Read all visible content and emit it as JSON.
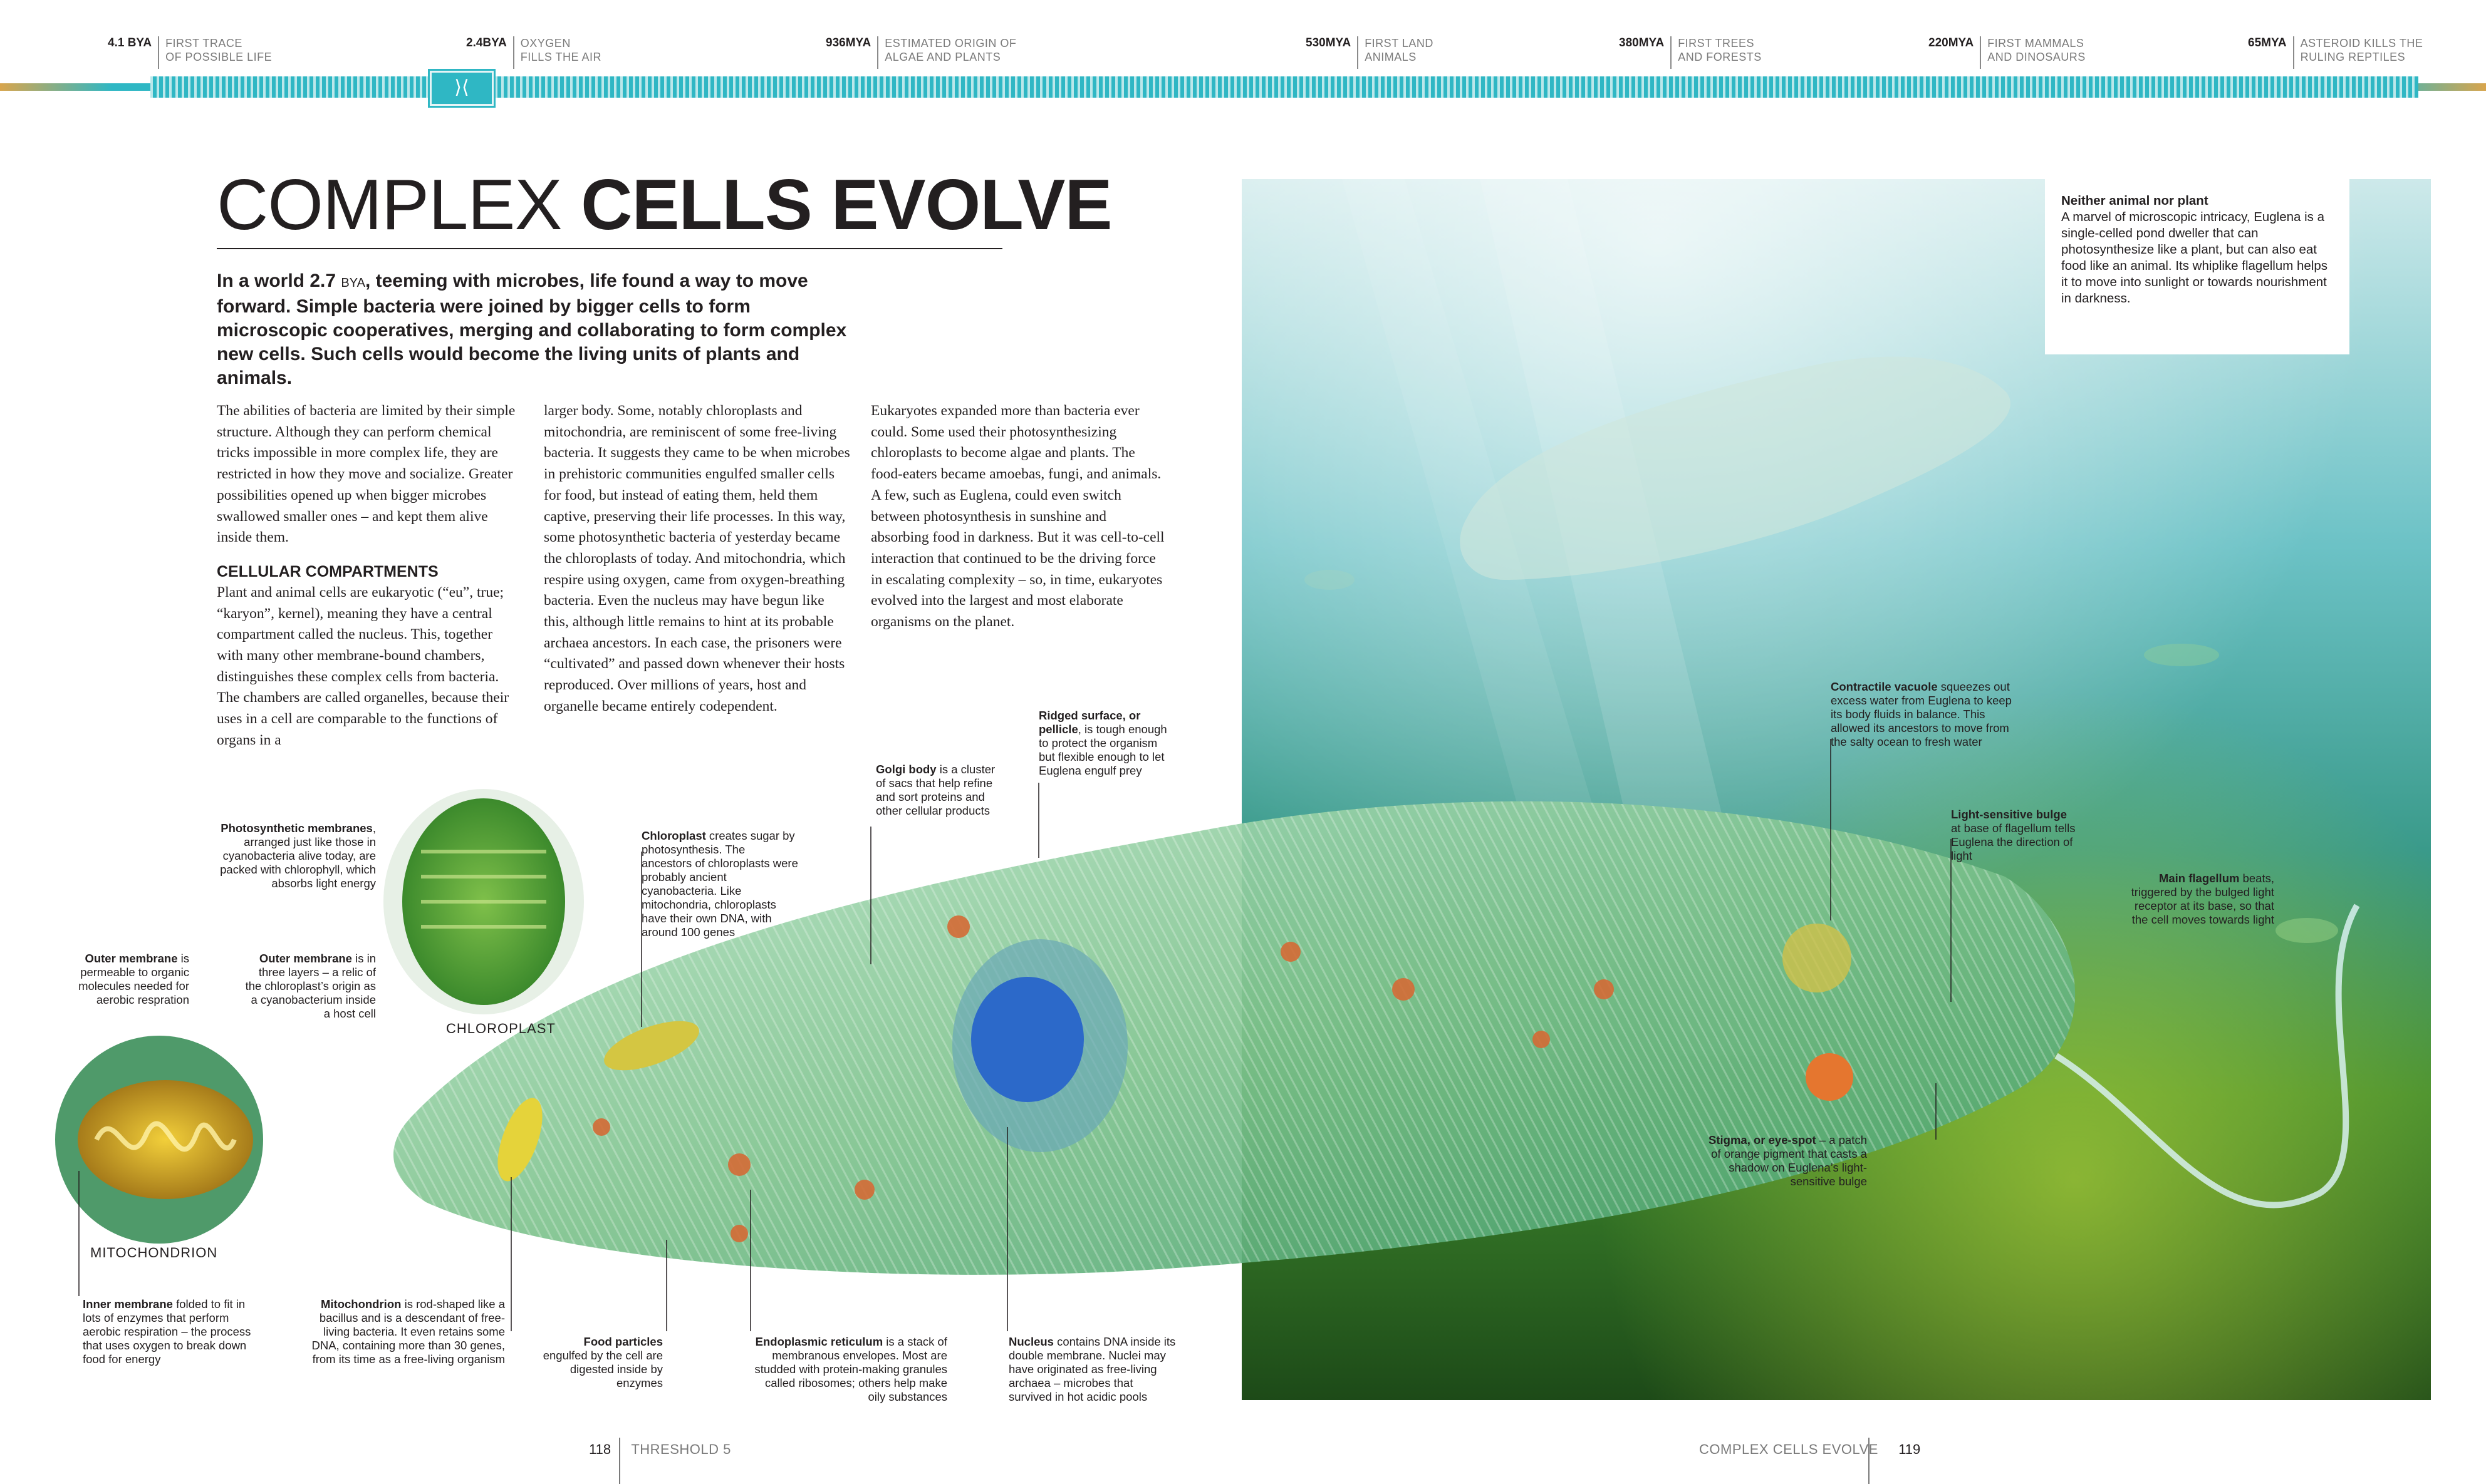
{
  "timeline": [
    {
      "date": "4.1 BYA",
      "desc_lines": [
        "First trace",
        "of possible life"
      ]
    },
    {
      "date": "2.4BYA",
      "desc_lines": [
        "Oxygen",
        "fills the air"
      ]
    },
    {
      "date": "936MYA",
      "desc_lines": [
        "Estimated origin of",
        "algae and plants"
      ]
    },
    {
      "date": "530MYA",
      "desc_lines": [
        "First land",
        "animals"
      ]
    },
    {
      "date": "380MYA",
      "desc_lines": [
        "First trees",
        "and forests"
      ]
    },
    {
      "date": "220MYA",
      "desc_lines": [
        "First mammals",
        "and dinosaurs"
      ]
    },
    {
      "date": "65MYA",
      "desc_lines": [
        "Asteroid kills the",
        "ruling reptiles"
      ]
    }
  ],
  "timeline_marker_glyph": "⟩⟨",
  "colors": {
    "timeline_teal": "#2fb7c4",
    "timeline_gold": "#d8a54d",
    "water_top": "#bfe3e6",
    "water_bottom": "#1d5a22"
  },
  "title": {
    "light": "COMPLEX ",
    "bold": "CELLS EVOLVE"
  },
  "intro": {
    "part1": "In a world 2.7 ",
    "unit": "BYA",
    "part2": ", teeming with microbes, life found a way to move forward. Simple bacteria were joined by bigger cells to form microscopic cooperatives, merging and collaborating to form complex new cells. Such cells would become the living units of plants and animals."
  },
  "body": {
    "p1": "The abilities of bacteria are limited by their simple structure. Although they can perform chemical tricks impossible in more complex life, they are restricted in how they move and socialize. Greater possibilities opened up when bigger microbes swallowed smaller ones – and kept them alive inside them.",
    "subhead": "Cellular compartments",
    "p2": "Plant and animal cells are eukaryotic (“eu”, true; “karyon”, kernel), meaning they have a central compartment called the nucleus. This, together with many other membrane-bound chambers, distinguishes these complex cells from bacteria. The chambers are called organelles, because their uses in a cell are comparable to the functions of organs in a",
    "p3": "larger body. Some, notably chloroplasts and mitochondria, are reminiscent of some free-living bacteria. It suggests they came to be when microbes in prehistoric communities engulfed smaller cells for food, but instead of eating them, held them captive, preserving their life processes. In this way, some photosynthetic bacteria of yesterday became the chloroplasts of today. And mitochondria, which respire using oxygen, came from oxygen-breathing bacteria. Even the nucleus may have begun like this, although little remains to hint at its probable archaea ancestors. In each case, the prisoners were “cultivated” and passed down whenever their hosts reproduced. Over millions of years, host and organelle became entirely codependent.",
    "p4": "Eukaryotes expanded more than bacteria ever could. Some used their photosynthesizing chloroplasts to become algae and plants. The food-eaters became amoebas, fungi, and animals. A few, such as Euglena, could even switch between photosynthesis in sunshine and absorbing food in darkness. But it was cell-to-cell interaction that continued to be the driving force in escalating complexity – so, in time, eukaryotes evolved into the largest and most elaborate organisms on the planet."
  },
  "infobox": {
    "heading": "Neither animal nor plant",
    "text": "A marvel of microscopic intricacy, Euglena is a single-celled pond dweller that can photosynthesize like a plant, but can also eat food like an animal. Its whiplike flagellum helps it to move into sunlight or towards nourishment in darkness."
  },
  "labels": {
    "chloroplast": "CHLOROPLAST",
    "mitochondrion": "MITOCHONDRION"
  },
  "callouts": {
    "photo_membranes": {
      "term": "Photosynthetic membranes",
      "text": ", arranged just like those in cyanobacteria alive today, are packed with chlorophyll, which absorbs light energy"
    },
    "outer_membrane_chloro": {
      "term": "Outer membrane",
      "text": " is in three layers – a relic of the chloroplast’s origin as a cyanobacterium inside a host cell"
    },
    "outer_membrane_mito": {
      "term": "Outer membrane",
      "text": " is permeable to organic molecules needed for aerobic respration"
    },
    "chloroplast": {
      "term": "Chloroplast",
      "text": " creates sugar by photosynthesis. The ancestors of chloroplasts were probably ancient cyanobacteria. Like mitochondria, chloroplasts have their own DNA, with around 100 genes"
    },
    "golgi": {
      "term": "Golgi body",
      "text": " is a cluster of sacs that help refine and sort proteins and other cellular products"
    },
    "pellicle": {
      "term": "Ridged surface, or pellicle",
      "text": ", is tough enough to protect the organism but flexible enough to let Euglena engulf prey"
    },
    "contractile": {
      "term": "Contractile vacuole",
      "text": " squeezes out excess water from Euglena to keep its body fluids in balance. This allowed its ancestors to move from the salty ocean to fresh water"
    },
    "light_bulge": {
      "term": "Light-sensitive bulge",
      "text": " at base of flagellum tells Euglena the direction of light"
    },
    "main_flagellum": {
      "term": "Main flagellum",
      "text": " beats, triggered by the bulged light receptor at its base, so that the cell moves towards light"
    },
    "stigma": {
      "term": "Stigma, or eye-spot",
      "text": " – a patch of orange pigment that casts a shadow on Euglena’s light-sensitive bulge"
    },
    "inner_membrane": {
      "term": "Inner membrane",
      "text": " folded to fit in lots of enzymes that perform aerobic respiration – the process that uses oxygen to break down food for energy"
    },
    "mitochondrion": {
      "term": "Mitochondrion",
      "text": " is rod-shaped like a bacillus and is a descendant of free-living bacteria. It even retains some DNA, containing more than 30 genes, from its time as a free-living organism"
    },
    "food_particles": {
      "term": "Food particles",
      "text": " engulfed by the cell are digested inside by enzymes"
    },
    "er": {
      "term": "Endoplasmic reticulum",
      "text": " is a stack of membranous envelopes. Most are studded with protein-making granules called ribosomes; others help make oily substances"
    },
    "nucleus": {
      "term": "Nucleus",
      "text": " contains DNA inside its double membrane. Nuclei may have originated as free-living archaea – microbes that survived in hot acidic pools"
    }
  },
  "footer": {
    "left_page": "118",
    "left_section": "THRESHOLD 5",
    "right_section": "COMPLEX CELLS EVOLVE",
    "right_page": "119"
  }
}
